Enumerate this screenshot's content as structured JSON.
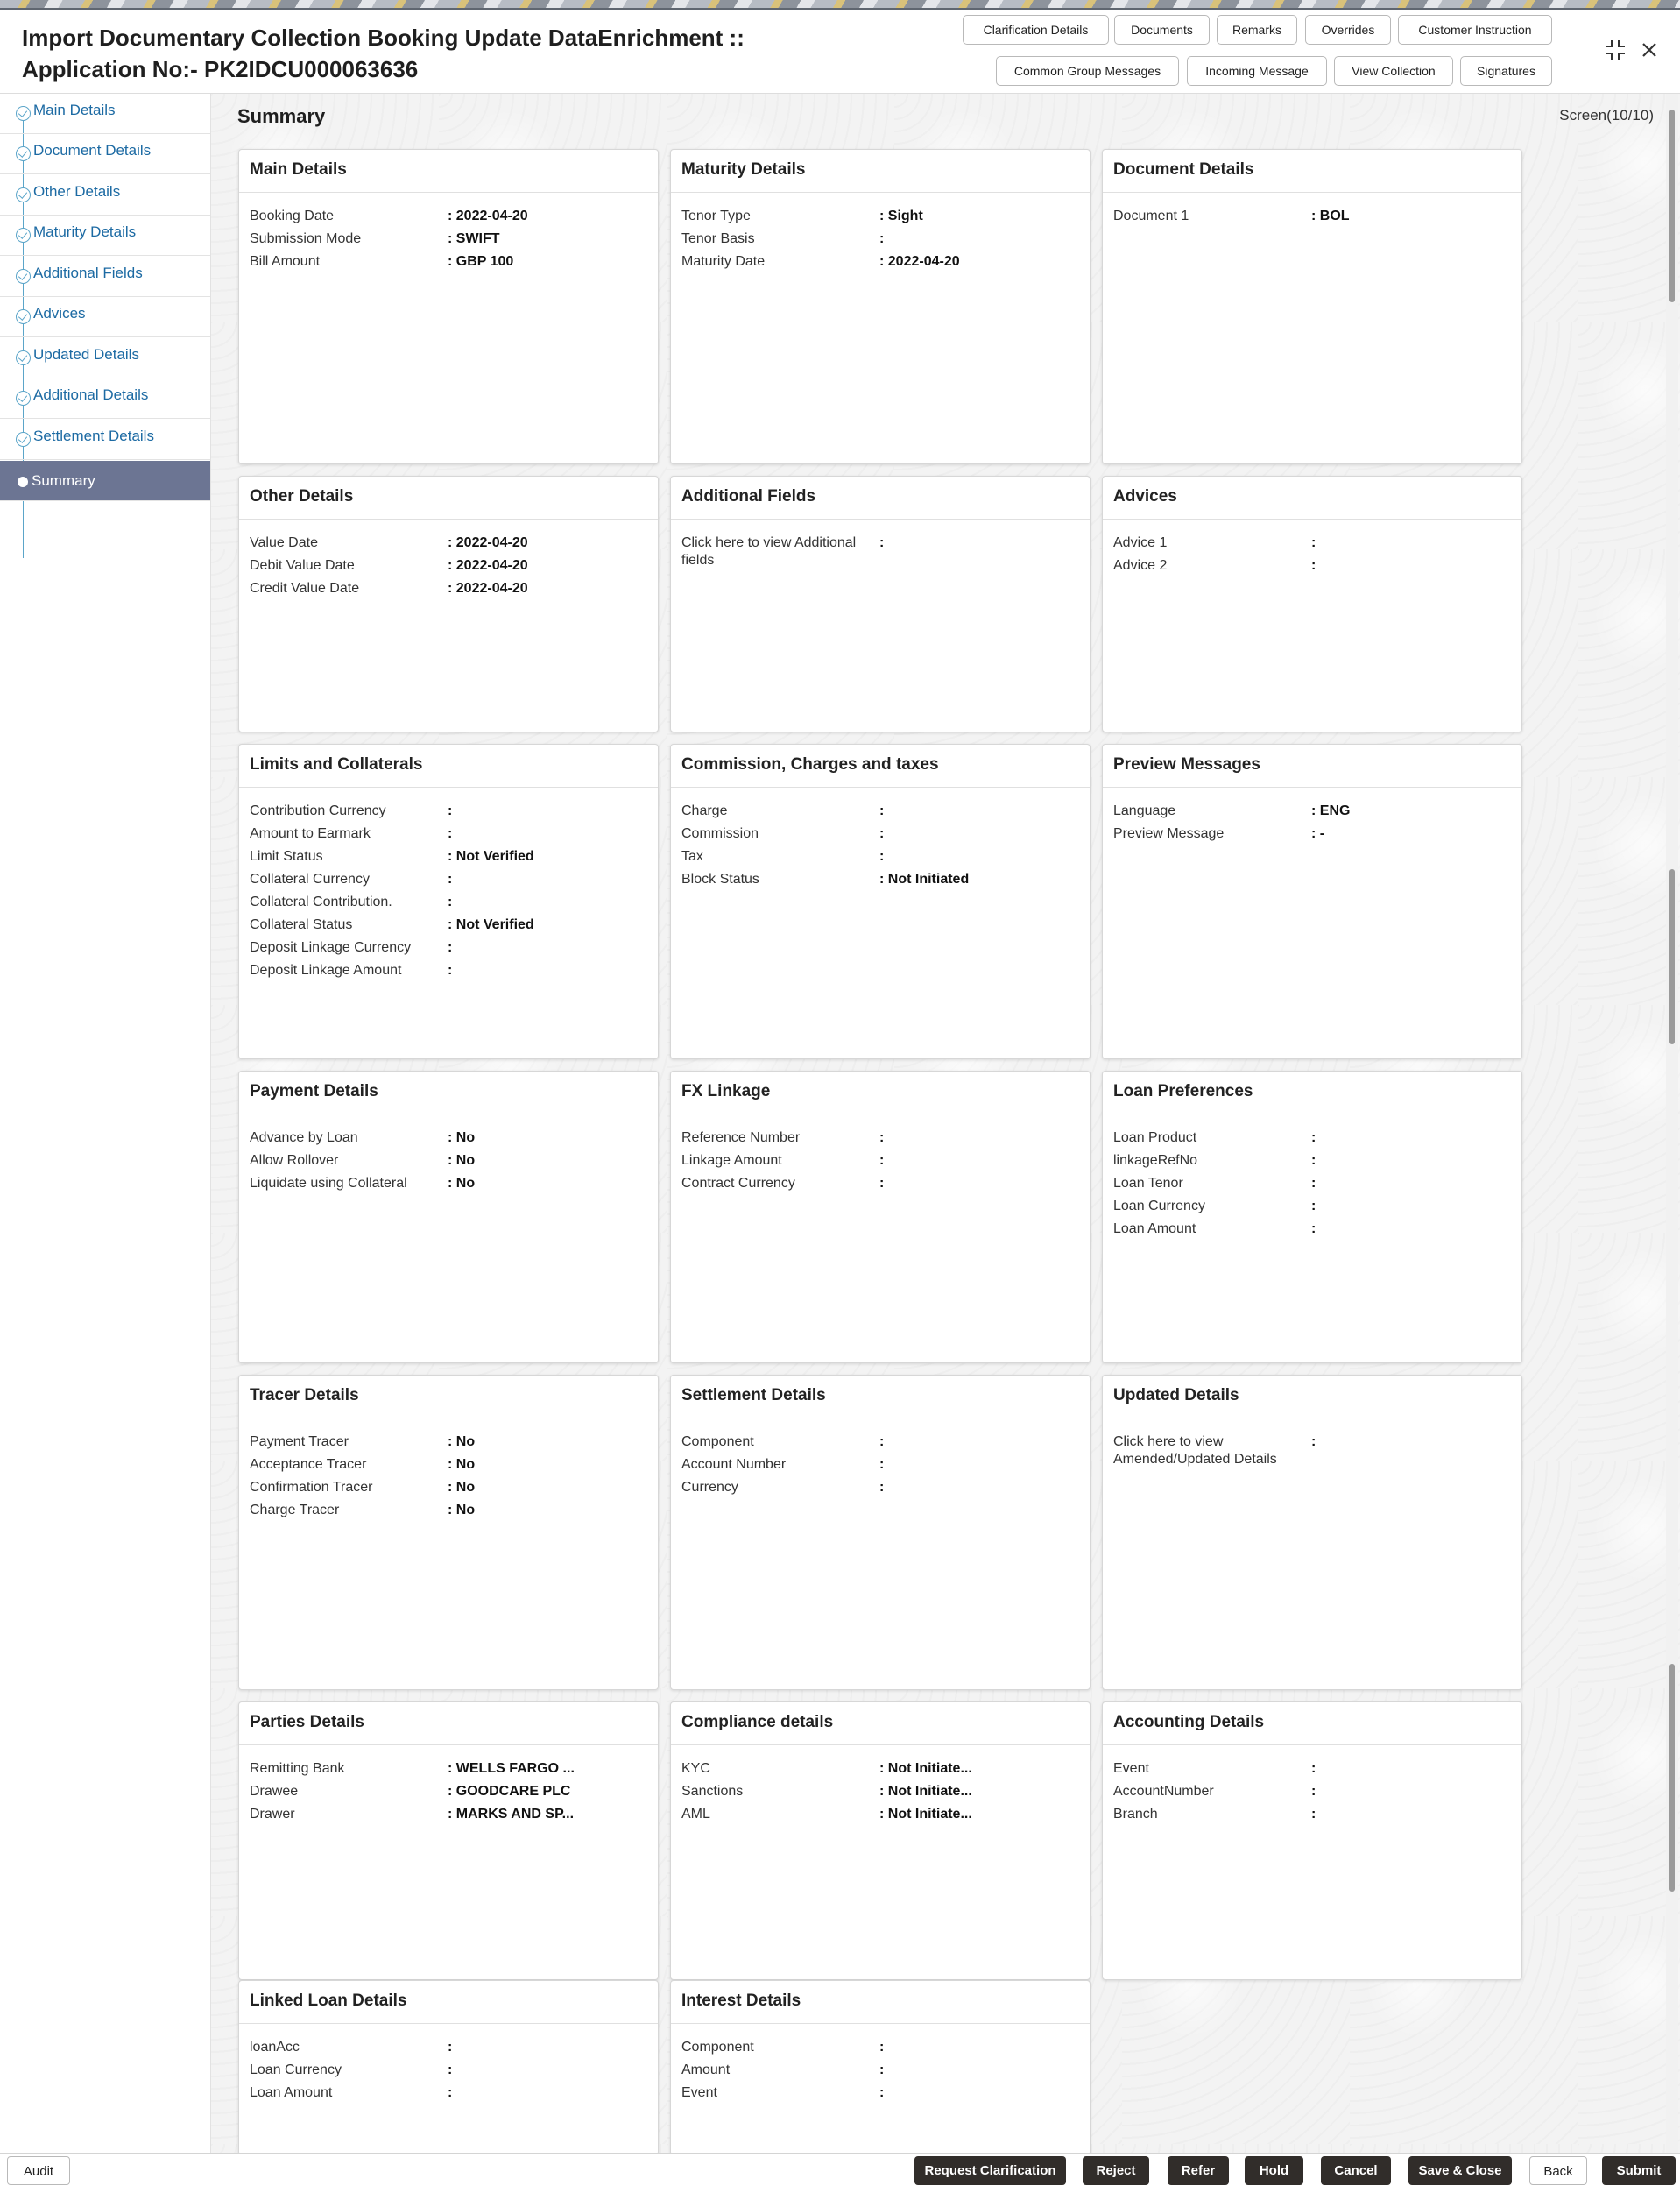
{
  "header": {
    "title_line1": "Import Documentary Collection Booking Update DataEnrichment ::",
    "title_line2": "Application No:- PK2IDCU000063636",
    "buttons_row1": [
      "Clarification Details",
      "Documents",
      "Remarks",
      "Overrides",
      "Customer Instruction"
    ],
    "buttons_row2": [
      "Common Group Messages",
      "Incoming Message",
      "View Collection",
      "Signatures"
    ],
    "icons": [
      "collapse-icon",
      "close-icon"
    ]
  },
  "sidebar": {
    "items": [
      {
        "label": "Main Details"
      },
      {
        "label": "Document Details"
      },
      {
        "label": "Other Details"
      },
      {
        "label": "Maturity Details"
      },
      {
        "label": "Additional Fields"
      },
      {
        "label": "Advices"
      },
      {
        "label": "Updated Details"
      },
      {
        "label": "Additional Details"
      },
      {
        "label": "Settlement Details"
      },
      {
        "label": "Summary",
        "active": true
      }
    ]
  },
  "main": {
    "title": "Summary",
    "screen": "Screen(10/10)"
  },
  "cards": [
    {
      "title": "Main Details",
      "rows": [
        {
          "k": "Booking Date",
          "v": ": 2022-04-20"
        },
        {
          "k": "Submission Mode",
          "v": ": SWIFT"
        },
        {
          "k": "Bill Amount",
          "v": ": GBP 100"
        }
      ]
    },
    {
      "title": "Maturity Details",
      "rows": [
        {
          "k": "Tenor Type",
          "v": ": Sight"
        },
        {
          "k": "Tenor Basis",
          "v": ":"
        },
        {
          "k": "Maturity Date",
          "v": ": 2022-04-20"
        }
      ]
    },
    {
      "title": "Document Details",
      "rows": [
        {
          "k": "Document 1",
          "v": ": BOL"
        }
      ]
    },
    {
      "title": "Other Details",
      "rows": [
        {
          "k": "Value Date",
          "v": ": 2022-04-20"
        },
        {
          "k": "Debit Value Date",
          "v": ": 2022-04-20"
        },
        {
          "k": "Credit Value Date",
          "v": ": 2022-04-20"
        }
      ]
    },
    {
      "title": "Additional Fields",
      "rows": [
        {
          "k": "Click here to view Additional fields",
          "v": ":"
        }
      ]
    },
    {
      "title": "Advices",
      "rows": [
        {
          "k": "Advice 1",
          "v": ":"
        },
        {
          "k": "Advice 2",
          "v": ":"
        }
      ]
    },
    {
      "title": "Limits and Collaterals",
      "rows": [
        {
          "k": "Contribution Currency",
          "v": ":"
        },
        {
          "k": "Amount to Earmark",
          "v": ":"
        },
        {
          "k": "Limit Status",
          "v": ": Not Verified"
        },
        {
          "k": "Collateral Currency",
          "v": ":"
        },
        {
          "k": "Collateral Contribution.",
          "v": ":"
        },
        {
          "k": "Collateral Status",
          "v": ": Not Verified"
        },
        {
          "k": "Deposit Linkage Currency",
          "v": ":"
        },
        {
          "k": "Deposit Linkage Amount",
          "v": ":"
        }
      ]
    },
    {
      "title": "Commission, Charges and taxes",
      "rows": [
        {
          "k": "Charge",
          "v": ":"
        },
        {
          "k": "Commission",
          "v": ":"
        },
        {
          "k": "Tax",
          "v": ":"
        },
        {
          "k": "Block Status",
          "v": ": Not Initiated"
        }
      ]
    },
    {
      "title": "Preview Messages",
      "rows": [
        {
          "k": "Language",
          "v": ": ENG"
        },
        {
          "k": "Preview Message",
          "v": ": -"
        }
      ]
    },
    {
      "title": "Payment Details",
      "rows": [
        {
          "k": "Advance by Loan",
          "v": ": No"
        },
        {
          "k": "Allow Rollover",
          "v": ": No"
        },
        {
          "k": "Liquidate using Collateral",
          "v": ": No"
        }
      ]
    },
    {
      "title": "FX Linkage",
      "rows": [
        {
          "k": "Reference Number",
          "v": ":"
        },
        {
          "k": "Linkage Amount",
          "v": ":"
        },
        {
          "k": "Contract Currency",
          "v": ":"
        }
      ]
    },
    {
      "title": "Loan Preferences",
      "rows": [
        {
          "k": "Loan Product",
          "v": ":"
        },
        {
          "k": "linkageRefNo",
          "v": ":"
        },
        {
          "k": "Loan Tenor",
          "v": ":"
        },
        {
          "k": "Loan Currency",
          "v": ":"
        },
        {
          "k": "Loan Amount",
          "v": ":"
        }
      ]
    },
    {
      "title": "Tracer Details",
      "rows": [
        {
          "k": "Payment Tracer",
          "v": ": No"
        },
        {
          "k": "Acceptance Tracer",
          "v": ": No"
        },
        {
          "k": "Confirmation Tracer",
          "v": ": No"
        },
        {
          "k": "Charge Tracer",
          "v": ": No"
        }
      ]
    },
    {
      "title": "Settlement Details",
      "rows": [
        {
          "k": "Component",
          "v": ":"
        },
        {
          "k": "Account Number",
          "v": ":"
        },
        {
          "k": "Currency",
          "v": ":"
        }
      ]
    },
    {
      "title": "Updated Details",
      "rows": [
        {
          "k": "Click here to view Amended/Updated Details",
          "v": ":"
        }
      ]
    },
    {
      "title": "Parties Details",
      "rows": [
        {
          "k": "Remitting Bank",
          "v": ": WELLS FARGO ..."
        },
        {
          "k": "Drawee",
          "v": ": GOODCARE PLC"
        },
        {
          "k": "Drawer",
          "v": ": MARKS AND SP..."
        }
      ]
    },
    {
      "title": "Compliance details",
      "rows": [
        {
          "k": "KYC",
          "v": ": Not Initiate..."
        },
        {
          "k": "Sanctions",
          "v": ": Not Initiate..."
        },
        {
          "k": "AML",
          "v": ": Not Initiate..."
        }
      ]
    },
    {
      "title": "Accounting Details",
      "rows": [
        {
          "k": "Event",
          "v": ":"
        },
        {
          "k": "AccountNumber",
          "v": ":"
        },
        {
          "k": "Branch",
          "v": ":"
        }
      ]
    },
    {
      "title": "Linked Loan Details",
      "rows": [
        {
          "k": "loanAcc",
          "v": ":"
        },
        {
          "k": "Loan Currency",
          "v": ":"
        },
        {
          "k": "Loan Amount",
          "v": ":"
        }
      ]
    },
    {
      "title": "Interest Details",
      "rows": [
        {
          "k": "Component",
          "v": ":"
        },
        {
          "k": "Amount",
          "v": ":"
        },
        {
          "k": "Event",
          "v": ":"
        }
      ]
    }
  ],
  "footer": {
    "audit": "Audit",
    "buttons": [
      "Request Clarification",
      "Reject",
      "Refer",
      "Hold",
      "Cancel",
      "Save & Close",
      "Back",
      "Submit"
    ]
  },
  "colors": {
    "sidebar_active": "#6c7593",
    "link": "#1c6aa3",
    "primary_button": "#312d2a"
  }
}
